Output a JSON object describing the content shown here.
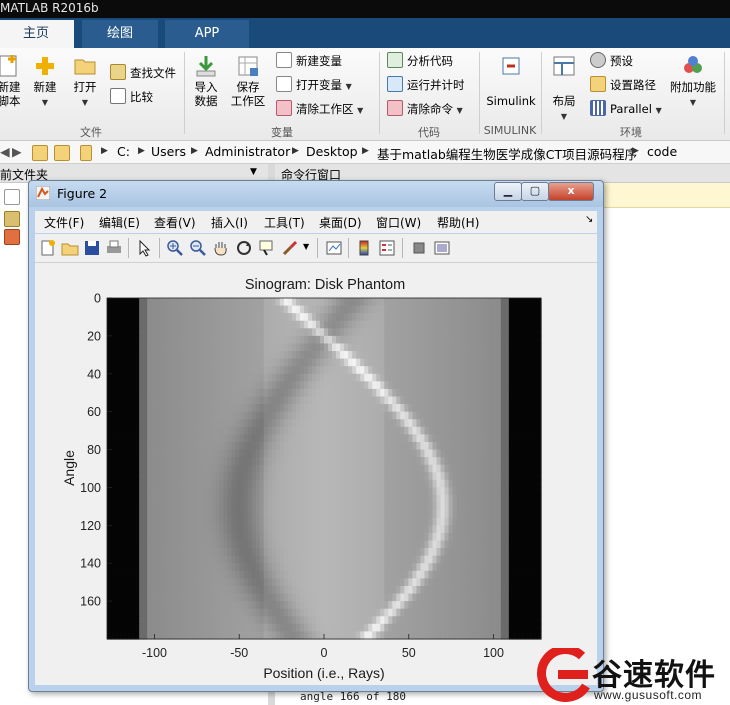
{
  "app": {
    "title": "MATLAB R2016b"
  },
  "tabs": [
    {
      "label": "主页"
    },
    {
      "label": "绘图"
    },
    {
      "label": "APP"
    }
  ],
  "ribbon": {
    "file": {
      "group_label": "文件",
      "new_script": "新建\n脚本",
      "new": "新建",
      "open": "打开",
      "find_files": "查找文件",
      "compare": "比较"
    },
    "variable": {
      "group_label": "变量",
      "import_data": "导入\n数据",
      "save_workspace": "保存\n工作区",
      "new_variable": "新建变量",
      "open_variable": "打开变量",
      "clear_workspace": "清除工作区"
    },
    "code": {
      "group_label": "代码",
      "analyze_code": "分析代码",
      "run_and_time": "运行并计时",
      "clear_commands": "清除命令"
    },
    "simulink": {
      "group_label": "SIMULINK",
      "simulink": "Simulink"
    },
    "environment": {
      "group_label": "环境",
      "layout": "布局",
      "preferences": "预设",
      "set_path": "设置路径",
      "parallel": "Parallel",
      "add_ons": "附加功能"
    }
  },
  "address": {
    "crumbs": [
      "C:",
      "Users",
      "Administrator",
      "Desktop",
      "基于matlab编程生物医学成像CT项目源码程序",
      "code"
    ]
  },
  "panels": {
    "current_folder": "前文件夹",
    "command_window": "命令行窗口",
    "command_output": "angle 166 of 180"
  },
  "figure": {
    "title": "Figure 2",
    "menus": [
      "文件(F)",
      "编辑(E)",
      "查看(V)",
      "插入(I)",
      "工具(T)",
      "桌面(D)",
      "窗口(W)",
      "帮助(H)"
    ],
    "close_glyph": "x"
  },
  "chart_data": {
    "type": "heatmap",
    "title": "Sinogram: Disk Phantom",
    "xlabel": "Position (i.e., Rays)",
    "ylabel": "Angle",
    "x_ticks": [
      -100,
      -50,
      0,
      50,
      100
    ],
    "y_ticks": [
      0,
      20,
      40,
      60,
      80,
      100,
      120,
      140,
      160
    ],
    "xlim": [
      -128,
      128
    ],
    "ylim": [
      0,
      180
    ],
    "y_reversed": true,
    "colormap": "gray",
    "structure": {
      "support_edges_x": [
        -110,
        110
      ],
      "inner_support_x": [
        -105,
        105
      ],
      "vertical_band_edges_x": [
        -35,
        35
      ],
      "bright_sinusoid": {
        "center_x": 0,
        "amplitude": 70,
        "phase_deg": -20,
        "gray": 0.95
      },
      "dark_sinusoid": {
        "center_x": 0,
        "amplitude": 50,
        "phase_deg": 160,
        "gray": 0.35
      }
    }
  },
  "watermark": {
    "name": "谷速软件",
    "url": "www.gususoft.com",
    "color": "#e0201c"
  }
}
